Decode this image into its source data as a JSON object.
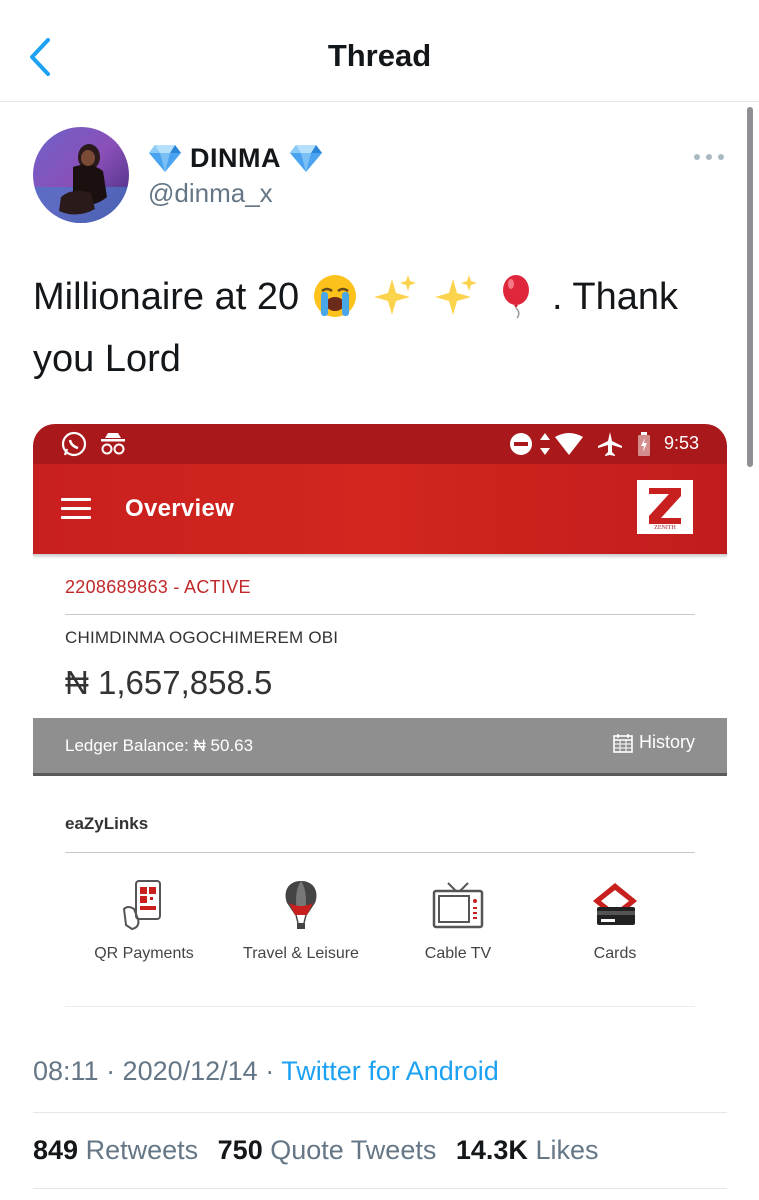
{
  "header": {
    "title": "Thread"
  },
  "tweet": {
    "display_name": "DINMA",
    "handle": "@dinma_x",
    "text_before": "Millionaire at 20",
    "text_after": ". Thank you Lord",
    "emojis": [
      "loudly-crying-face",
      "sparkles",
      "sparkles",
      "balloon"
    ],
    "timestamp": "08:11 · 2020/12/14 · ",
    "source": "Twitter for Android"
  },
  "media": {
    "status_time": "9:53",
    "app_title": "Overview",
    "logo_text": "ZENITH",
    "account_number": "2208689863 - ACTIVE",
    "account_name": "CHIMDINMA OGOCHIMEREM OBI",
    "balance": "₦ 1,657,858.5",
    "ledger": "Ledger Balance: ₦ 50.63",
    "history_label": "History",
    "section_title": "eaZyLinks",
    "quick_links": [
      {
        "label": "QR Payments",
        "icon": "qr-phone-icon"
      },
      {
        "label": "Travel & Leisure",
        "icon": "hot-air-balloon-icon"
      },
      {
        "label": "Cable TV",
        "icon": "tv-icon"
      },
      {
        "label": "Cards",
        "icon": "cards-icon"
      }
    ],
    "colors": {
      "primary_red": "#c8201f",
      "status_red": "#a9191b",
      "ledger_grey": "#8f8f8f"
    }
  },
  "stats": {
    "retweets_count": "849",
    "retweets_label": "Retweets",
    "quotes_count": "750",
    "quotes_label": "Quote Tweets",
    "likes_count": "14.3K",
    "likes_label": "Likes"
  },
  "colors": {
    "link_blue": "#1da1f2",
    "secondary_text": "#657786",
    "verified_gem": "#4aa3f0"
  }
}
